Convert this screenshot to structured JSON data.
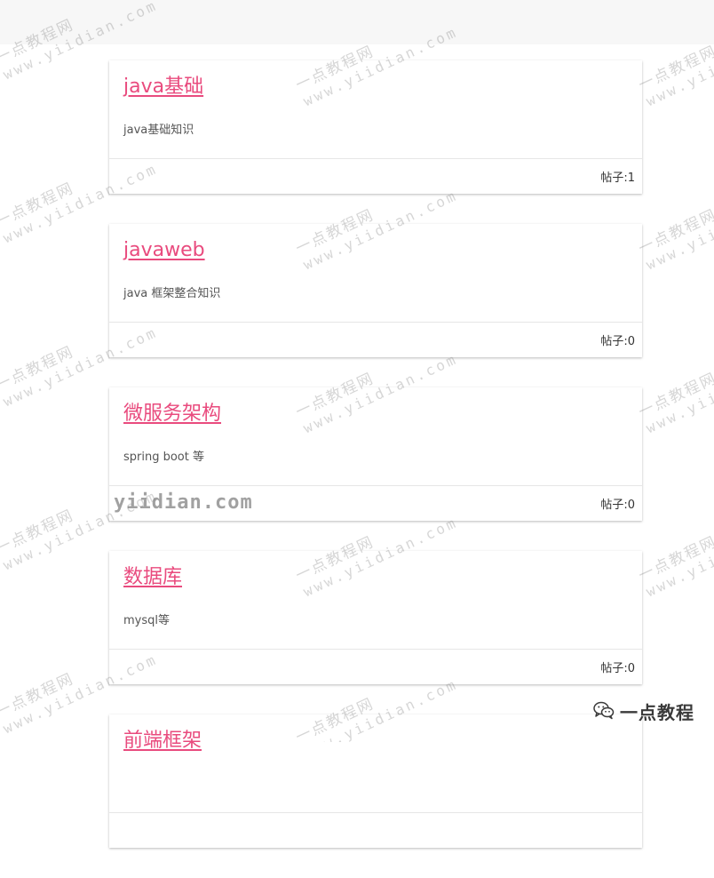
{
  "categories": [
    {
      "title": "java基础",
      "description": "java基础知识",
      "post_count": "帖子:1"
    },
    {
      "title": "javaweb",
      "description": "java 框架整合知识",
      "post_count": "帖子:0"
    },
    {
      "title": "微服务架构",
      "description": "spring boot 等",
      "post_count": "帖子:0"
    },
    {
      "title": "数据库",
      "description": "mysql等",
      "post_count": "帖子:0"
    },
    {
      "title": "前端框架",
      "description": "",
      "post_count": ""
    }
  ],
  "watermark": {
    "zh": "一点教程网",
    "en": "www.yiidian.com"
  },
  "site_stamp": "yiidian.com",
  "brand": {
    "text": "一点教程",
    "icon": "wechat-icon"
  },
  "colors": {
    "title_link": "#e94b7e",
    "description": "#555555",
    "footer_text": "#333333",
    "divider": "#e6e6e6",
    "top_bar": "#f7f7f7"
  }
}
